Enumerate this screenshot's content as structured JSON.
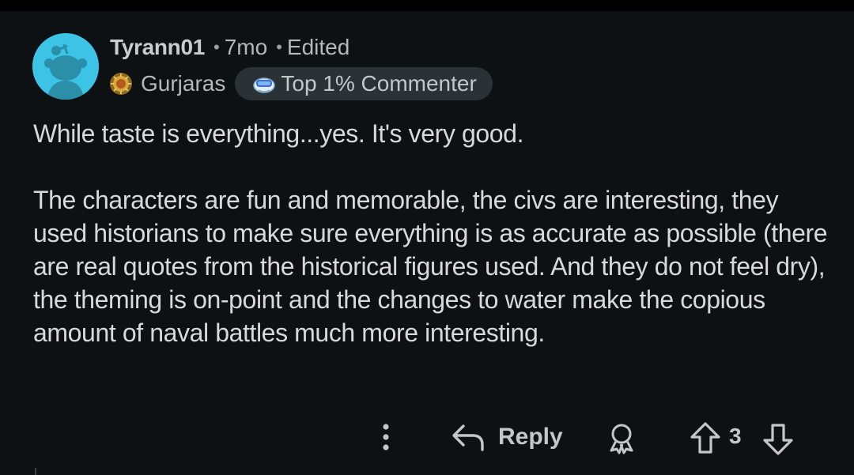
{
  "comment": {
    "author": "Tyrann01",
    "separator": "•",
    "age": "7mo",
    "edited_label": "Edited",
    "flair": {
      "icon": "sun-emblem-icon",
      "label": "Gurjaras"
    },
    "badge": {
      "icon": "achievement-goggles-icon",
      "label": "Top 1% Commenter"
    },
    "paragraphs": [
      "While taste is everything...yes. It's very good.",
      "The characters are fun and memorable, the civs are interesting, they used historians to make sure everything is as accurate as possible (there are real quotes from the historical figures used. And they do not feel dry), the theming is on-point and the changes to water make the copious amount of naval battles much more interesting."
    ]
  },
  "actions": {
    "more_icon": "more-vertical-icon",
    "reply_icon": "reply-arrow-icon",
    "reply_label": "Reply",
    "award_icon": "award-icon",
    "upvote_icon": "upvote-icon",
    "vote_count": "3",
    "downvote_icon": "downvote-icon"
  },
  "colors": {
    "background": "#0e1113",
    "avatar": "#3cc3e6",
    "text": "#d7dadc",
    "meta_text": "#b3b8bb",
    "badge_background": "#2a3236"
  }
}
